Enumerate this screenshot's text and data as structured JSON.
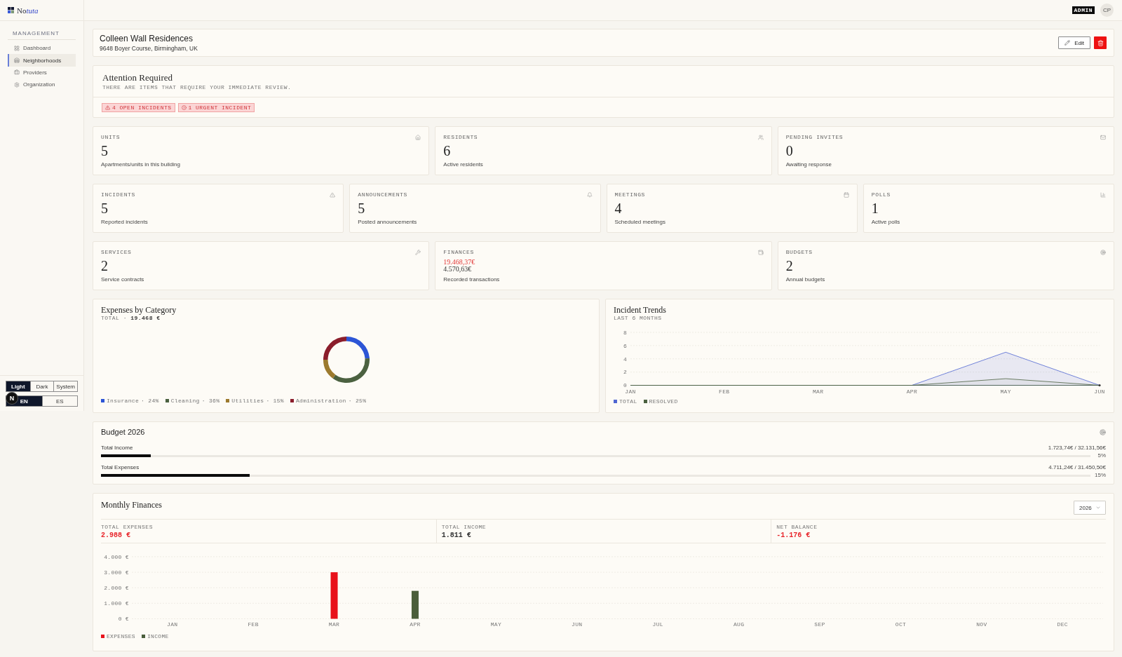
{
  "sidebar": {
    "brand": {
      "plain": "No",
      "accent": "tuta"
    },
    "section_title": "MANAGEMENT",
    "items": [
      {
        "label": "Dashboard",
        "selected": false
      },
      {
        "label": "Neighborhoods",
        "selected": true
      },
      {
        "label": "Providers",
        "selected": false
      },
      {
        "label": "Organization",
        "selected": false
      }
    ],
    "theme_options": [
      {
        "label": "Light",
        "selected": true
      },
      {
        "label": "Dark",
        "selected": false
      },
      {
        "label": "System",
        "selected": false
      }
    ],
    "language_options": [
      {
        "label": "EN",
        "selected": true
      },
      {
        "label": "ES",
        "selected": false
      }
    ]
  },
  "dev_badge": {
    "label": "N"
  },
  "topbar": {
    "role_badge": "ADMIN",
    "avatar_initials": "CP"
  },
  "building": {
    "name": "Colleen Wall Residences",
    "address": "9648 Boyer Course, Birmingham, UK",
    "edit_label": "Edit"
  },
  "attention": {
    "title": "Attention Required",
    "subtitle": "THERE ARE ITEMS THAT REQUIRE YOUR IMMEDIATE REVIEW.",
    "alerts": [
      {
        "kind": "warning",
        "label": "4 OPEN INCIDENTS"
      },
      {
        "kind": "urgent",
        "label": "1 URGENT INCIDENT"
      }
    ]
  },
  "stat_rows": [
    {
      "cards": [
        {
          "kind": "count",
          "label": "UNITS",
          "value": "5",
          "description": "Apartments/units in this building"
        },
        {
          "kind": "count",
          "label": "RESIDENTS",
          "value": "6",
          "description": "Active residents"
        },
        {
          "kind": "count",
          "label": "PENDING INVITES",
          "value": "0",
          "description": "Awaiting response"
        }
      ]
    },
    {
      "cards": [
        {
          "kind": "count",
          "label": "INCIDENTS",
          "value": "5",
          "description": "Reported incidents"
        },
        {
          "kind": "count",
          "label": "ANNOUNCEMENTS",
          "value": "5",
          "description": "Posted announcements"
        },
        {
          "kind": "count",
          "label": "MEETINGS",
          "value": "4",
          "description": "Scheduled meetings"
        },
        {
          "kind": "count",
          "label": "POLLS",
          "value": "1",
          "description": "Active polls"
        }
      ]
    },
    {
      "cards": [
        {
          "kind": "count",
          "label": "SERVICES",
          "value": "2",
          "description": "Service contracts"
        },
        {
          "kind": "amounts",
          "label": "FINANCES",
          "amounts": [
            {
              "text": "19.468,37€",
              "kind": "negative"
            },
            {
              "text": "4.570,63€",
              "kind": "neutral"
            }
          ],
          "description": "Recorded transactions"
        },
        {
          "kind": "count",
          "label": "BUDGETS",
          "value": "2",
          "description": "Annual budgets"
        }
      ]
    }
  ],
  "expenses_chart": {
    "title": "Expenses by Category",
    "subtitle": "TOTAL · **19.468 €**",
    "legend": [
      {
        "share": "· 24%",
        "color": "#2c55d6"
      },
      {
        "share": "· 36%",
        "color": "#4b6140"
      },
      {
        "share": "· 15%",
        "color": "#9c7a2e"
      },
      {
        "share": "· 25%",
        "color": "#8b1d2b"
      }
    ],
    "chart_data": {
      "type": "donut",
      "categories": [
        "Insurance",
        "Cleaning",
        "Utilities",
        "Administration"
      ],
      "values": [
        24,
        36,
        15,
        25
      ]
    }
  },
  "incident_chart": {
    "title": "Incident Trends",
    "subtitle": "LAST 6 MONTHS",
    "chart_data": {
      "type": "area",
      "categories": [
        "JAN",
        "FEB",
        "MAR",
        "APR",
        "MAY",
        "JUN"
      ],
      "series": [
        {
          "name": "TOTAL",
          "color": "#4f66d2",
          "values": [
            0,
            0,
            0,
            0,
            5,
            0
          ]
        },
        {
          "name": "RESOLVED",
          "color": "#4b6140",
          "values": [
            0,
            0,
            0,
            0,
            1,
            0
          ]
        }
      ],
      "ylim": [
        0,
        8
      ],
      "yticks": [
        {
          "value": 0,
          "label": "0"
        },
        {
          "value": 2,
          "label": "2"
        },
        {
          "value": 4,
          "label": "4"
        },
        {
          "value": 6,
          "label": "6"
        },
        {
          "value": 8,
          "label": "8"
        }
      ],
      "grid": true
    }
  },
  "budget": {
    "title": "Budget 2026",
    "lines": [
      {
        "label": "Total Income",
        "amount": "1.723,74€ / 32.131,56€",
        "level": 0.05,
        "percent": "5%"
      },
      {
        "label": "Total Expenses",
        "amount": "4.711,24€ / 31.450,50€",
        "level": 0.15,
        "percent": "15%"
      }
    ]
  },
  "monthly": {
    "title": "Monthly Finances",
    "year": "2026",
    "summary": [
      {
        "label": "TOTAL EXPENSES",
        "value": "2.988 €",
        "kind": "negative"
      },
      {
        "label": "TOTAL INCOME",
        "value": "1.811 €",
        "kind": "neutral"
      },
      {
        "label": "NET BALANCE",
        "value": "-1.176 €",
        "kind": "negative"
      }
    ],
    "chart_data": {
      "type": "bar",
      "categories": [
        "JAN",
        "FEB",
        "MAR",
        "APR",
        "MAY",
        "JUN",
        "JUL",
        "AUG",
        "SEP",
        "OCT",
        "NOV",
        "DEC"
      ],
      "series": [
        {
          "name": "EXPENSES",
          "color": "#e8121b",
          "values": [
            0,
            0,
            3000,
            0,
            0,
            0,
            0,
            0,
            0,
            0,
            0,
            0
          ]
        },
        {
          "name": "INCOME",
          "color": "#4a5e3c",
          "values": [
            0,
            0,
            0,
            1800,
            0,
            0,
            0,
            0,
            0,
            0,
            0,
            0
          ]
        }
      ],
      "ylim": [
        0,
        4000
      ],
      "yticks": [
        {
          "value": 0,
          "label": "0 €"
        },
        {
          "value": 1000,
          "label": "1.000 €"
        },
        {
          "value": 2000,
          "label": "2.000 €"
        },
        {
          "value": 3000,
          "label": "3.000 €"
        },
        {
          "value": 4000,
          "label": "4.000 €"
        }
      ],
      "grid": true
    }
  }
}
